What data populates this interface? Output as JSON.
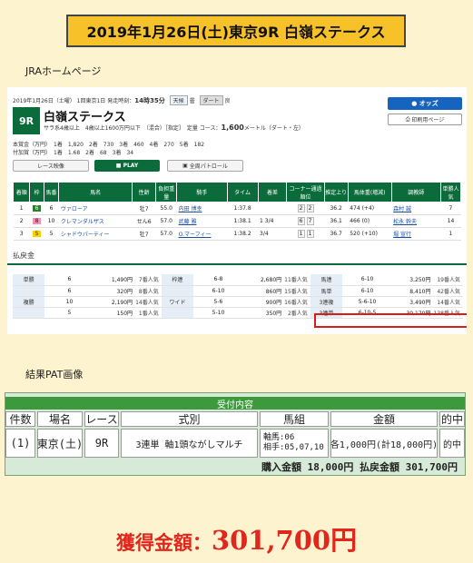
{
  "title": "2019年1月26日(土)東京9R 白嶺ステークス",
  "labels": {
    "jra": "JRAホームページ",
    "pat": "結果PAT画像"
  },
  "jra": {
    "date": "2019年1月26日（土曜）",
    "meeting": "1回東京1日",
    "start_label": "発走時刻：",
    "start_time": "14時35分",
    "weather_label": "天候",
    "weather": "曇",
    "track_label": "ダート",
    "track_cond": "良",
    "race_no": "9R",
    "race_name": "白嶺ステークス",
    "race_cond": "サラ系4歳以上　4歳以上1600万円以下　（混合）［指定］　定量",
    "course_label": "コース：",
    "course_distance": "1,600",
    "course_unit": "メートル（ダート・左）",
    "prize1": "本賞金（万円）　1着　1,820　2着　730　3着　460　4着　270　5着　182",
    "prize2": "付加賞（万円）　1着　1.68　2着　68　3着　34",
    "odds_button": "オッズ",
    "print_button": "印刷用ページ",
    "video_button": "レース映像",
    "play_button": "PLAY",
    "patrol_button": "全周パトロール",
    "result_headers": [
      "着順",
      "枠",
      "馬番",
      "馬名",
      "性齢",
      "負担重量",
      "騎手",
      "タイム",
      "着差",
      "コーナー通過順位",
      "推定上り",
      "馬体重(増減)",
      "調教師",
      "単勝人気"
    ],
    "results": [
      {
        "pos": "1",
        "waku": "6",
        "num": "6",
        "horse": "ヴァローア",
        "sexage": "牡7",
        "weight": "55.0",
        "jockey": "内田 博幸",
        "time": "1:37.8",
        "margin": "",
        "corner1": "2",
        "corner2": "2",
        "agari": "36.2",
        "bw": "474 (+4)",
        "trainer": "森村 誠",
        "pop": "7"
      },
      {
        "pos": "2",
        "waku": "8",
        "num": "10",
        "horse": "クレマンダルザス",
        "sexage": "せん6",
        "weight": "57.0",
        "jockey": "武藤 雅",
        "time": "1:38.1",
        "margin": "1 3/4",
        "corner1": "6",
        "corner2": "7",
        "agari": "36.1",
        "bw": "466 (0)",
        "trainer": "松永 幹夫",
        "pop": "14"
      },
      {
        "pos": "3",
        "waku": "5",
        "num": "5",
        "horse": "シャドウパーティー",
        "sexage": "牡7",
        "weight": "57.0",
        "jockey": "O.マーフィー",
        "time": "1:38.2",
        "margin": "3/4",
        "corner1": "1",
        "corner2": "1",
        "agari": "36.7",
        "bw": "520 (+10)",
        "trainer": "堀 宣行",
        "pop": "1"
      }
    ],
    "payout_title": "払戻金",
    "payouts": {
      "left": [
        {
          "type": "単勝",
          "num": "6",
          "yen": "1,490円",
          "pop": "7番人気"
        },
        {
          "type": "",
          "num": "6",
          "yen": "320円",
          "pop": "8番人気"
        },
        {
          "type": "複勝",
          "num": "10",
          "yen": "2,190円",
          "pop": "14番人気"
        },
        {
          "type": "",
          "num": "5",
          "yen": "150円",
          "pop": "1番人気"
        }
      ],
      "mid": [
        {
          "type": "枠連",
          "num": "6-8",
          "yen": "2,680円",
          "pop": "11番人気"
        },
        {
          "type": "",
          "num": "6-10",
          "yen": "860円",
          "pop": "15番人気"
        },
        {
          "type": "ワイド",
          "num": "5-6",
          "yen": "900円",
          "pop": "16番人気"
        },
        {
          "type": "",
          "num": "5-10",
          "yen": "350円",
          "pop": "2番人気"
        }
      ],
      "right": [
        {
          "type": "馬連",
          "num": "6-10",
          "yen": "3,250円",
          "pop": "19番人気"
        },
        {
          "type": "馬単",
          "num": "6-10",
          "yen": "8,410円",
          "pop": "42番人気"
        },
        {
          "type": "3連複",
          "num": "5-6-10",
          "yen": "3,490円",
          "pop": "14番人気"
        },
        {
          "type": "3連単",
          "num": "6-10-5",
          "yen": "30,170円",
          "pop": "138番人気"
        }
      ]
    }
  },
  "pat": {
    "header": "受付内容",
    "cols": [
      "件数",
      "場名",
      "レース",
      "式別",
      "馬組",
      "金額",
      "的中"
    ],
    "row": {
      "count": "(1)",
      "place": "東京(土)",
      "race": "9R",
      "type": "3連単 軸1頭ながしマルチ",
      "horse_axis": "軸馬:06",
      "horse_partner": "相手:05,07,10",
      "amount": "各1,000円(計18,000円)",
      "hit": "的中"
    },
    "purchase": "購入金額 18,000円",
    "refund": "払戻金額 301,700円"
  },
  "gain": {
    "label": "獲得金額：",
    "amount": "301,700円"
  }
}
